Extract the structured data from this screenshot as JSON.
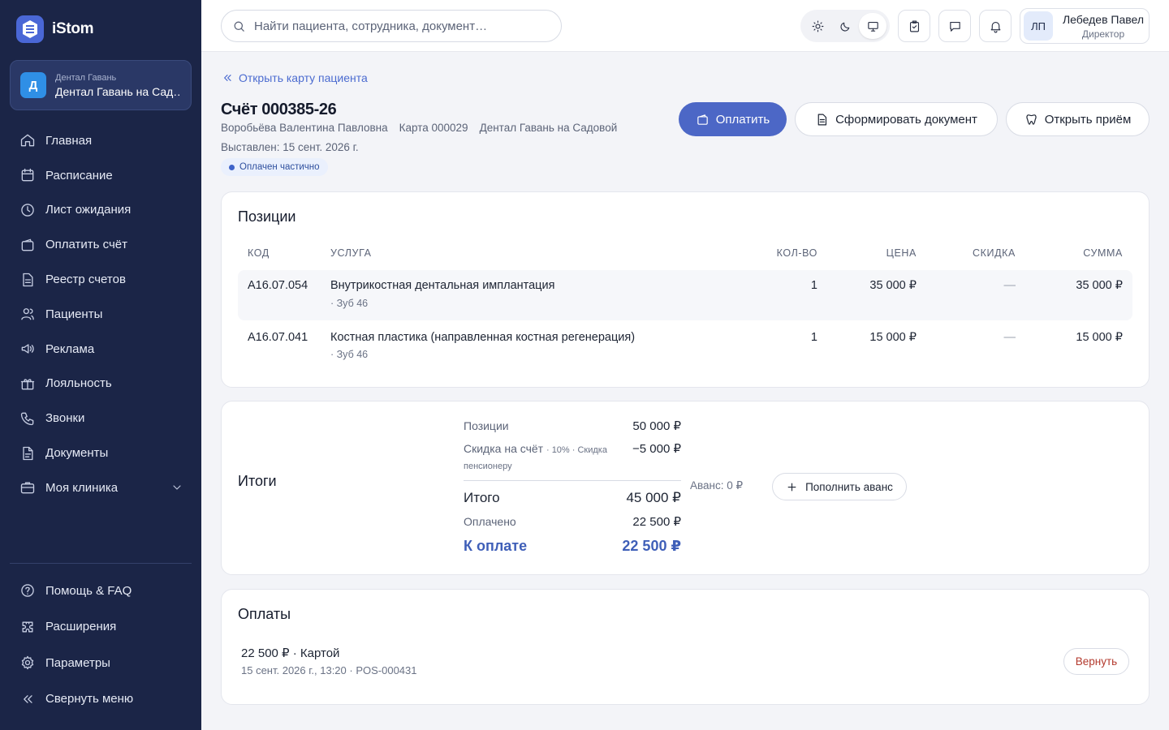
{
  "brand": {
    "name": "iStom"
  },
  "clinic": {
    "avatar": "Д",
    "subtitle": "Дентал Гавань",
    "name": "Дентал Гавань на Садовой"
  },
  "sidebar": {
    "items": [
      {
        "label": "Главная",
        "icon": "home-icon"
      },
      {
        "label": "Расписание",
        "icon": "calendar-icon"
      },
      {
        "label": "Лист ожидания",
        "icon": "clock-icon"
      },
      {
        "label": "Оплатить счёт",
        "icon": "wallet-icon"
      },
      {
        "label": "Реестр счетов",
        "icon": "document-icon"
      },
      {
        "label": "Пациенты",
        "icon": "users-icon"
      },
      {
        "label": "Реклама",
        "icon": "megaphone-icon"
      },
      {
        "label": "Лояльность",
        "icon": "gift-icon"
      },
      {
        "label": "Звонки",
        "icon": "phone-icon"
      },
      {
        "label": "Документы",
        "icon": "file-icon"
      },
      {
        "label": "Моя клиника",
        "icon": "briefcase-icon"
      }
    ],
    "bottom": [
      {
        "label": "Помощь & FAQ",
        "icon": "help-icon"
      },
      {
        "label": "Расширения",
        "icon": "puzzle-icon"
      },
      {
        "label": "Параметры",
        "icon": "settings-icon"
      },
      {
        "label": "Свернуть меню",
        "icon": "collapse-icon"
      }
    ]
  },
  "topbar": {
    "search_placeholder": "Найти пациента, сотрудника, документ…",
    "user": {
      "initials": "ЛП",
      "name": "Лебедев Павел",
      "role": "Директор"
    }
  },
  "invoice": {
    "back_link": "Открыть карту пациента",
    "title": "Счёт 000385-26",
    "patient": "Воробьёва Валентина Павловна",
    "card": "Карта 000029",
    "clinic": "Дентал Гавань на Садовой",
    "issued": "Выставлен: 15 сент. 2026 г.",
    "status": "Оплачен частично",
    "actions": {
      "pay": "Оплатить",
      "generate": "Сформировать документ",
      "open_visit": "Открыть приём"
    }
  },
  "positions": {
    "title": "Позиции",
    "columns": {
      "code": "КОД",
      "service": "УСЛУГА",
      "qty": "КОЛ-ВО",
      "price": "ЦЕНА",
      "discount": "СКИДКА",
      "sum": "СУММА"
    },
    "rows": [
      {
        "code": "A16.07.054",
        "service": "Внутрикостная дентальная имплантация",
        "note": "· Зуб 46",
        "qty": "1",
        "price": "35 000 ₽",
        "discount": "—",
        "sum": "35 000 ₽"
      },
      {
        "code": "A16.07.041",
        "service": "Костная пластика (направленная костная регенерация)",
        "note": "· Зуб 46",
        "qty": "1",
        "price": "15 000 ₽",
        "discount": "—",
        "sum": "15 000 ₽"
      }
    ]
  },
  "totals": {
    "title": "Итоги",
    "positions_label": "Позиции",
    "positions_value": "50 000 ₽",
    "discount_label": "Скидка на счёт",
    "discount_note_1": "· 10% · Скидка",
    "discount_note_2": "пенсионеру",
    "discount_value": "−5 000 ₽",
    "total_label": "Итого",
    "total_value": "45 000 ₽",
    "paid_label": "Оплачено",
    "paid_value": "22 500 ₽",
    "due_label": "К оплате",
    "due_value": "22 500 ₽",
    "advance": "Аванс: 0 ₽",
    "advance_button": "Пополнить аванс",
    "accent_color": "#3f5fb8"
  },
  "payments": {
    "title": "Оплаты",
    "items": [
      {
        "amount": "22 500 ₽ · Картой",
        "details": "15 сент. 2026 г., 13:20 · POS-000431",
        "refund": "Вернуть"
      }
    ]
  }
}
